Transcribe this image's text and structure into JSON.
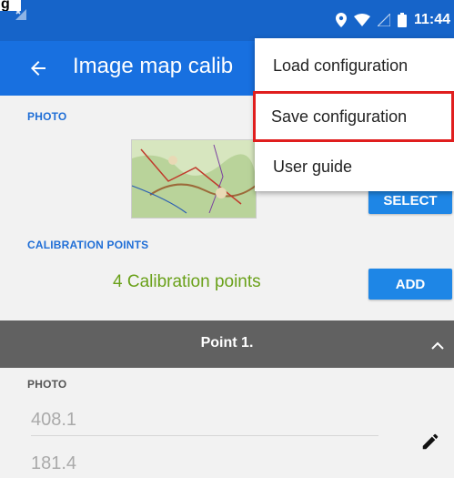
{
  "status_bar": {
    "time": "11:44",
    "icons": [
      "location-icon",
      "wifi-icon",
      "signal-icon",
      "battery-icon"
    ]
  },
  "app_bar": {
    "title": "Image map calib",
    "back_icon": "arrow-left-icon"
  },
  "photo_section": {
    "label": "PHOTO",
    "select_label": "SELECT"
  },
  "calibration_section": {
    "label": "CALIBRATION POINTS",
    "count_text": "4 Calibration points",
    "add_label": "ADD"
  },
  "point": {
    "header": "Point 1.",
    "photo_label": "PHOTO",
    "values": [
      "408.1",
      "181.4"
    ]
  },
  "overflow_menu": {
    "items": [
      "Load configuration",
      "Save configuration",
      "User guide"
    ],
    "highlighted_index": 1
  },
  "colors": {
    "status_bar": "#1664c9",
    "app_bar": "#1870e0",
    "accent": "#1e86e6",
    "calibration_text": "#6aa11a",
    "point_header": "#616161",
    "highlight": "#e01e1e"
  }
}
